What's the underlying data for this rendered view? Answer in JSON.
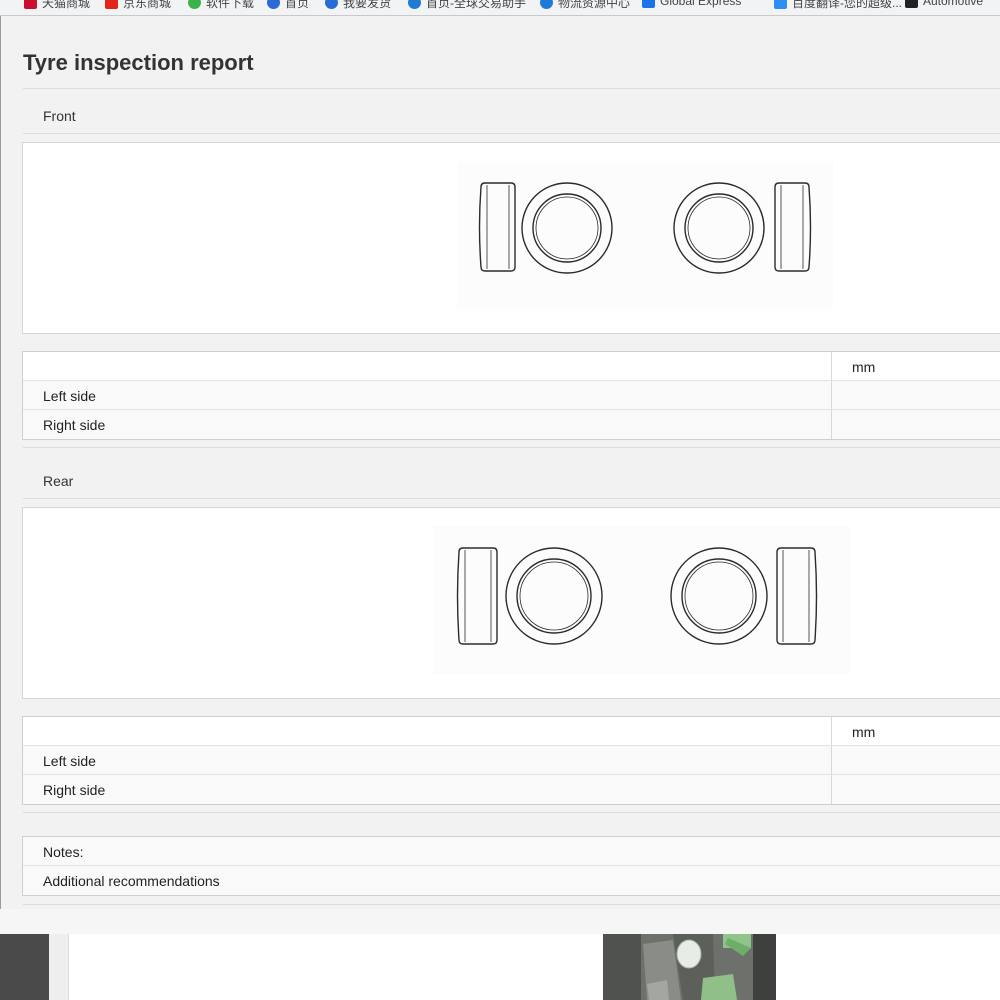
{
  "bookmarks": [
    {
      "label": "天猫商城",
      "color": "#c8102e"
    },
    {
      "label": "京东商城",
      "color": "#e1251b"
    },
    {
      "label": "软件下载",
      "color": "#3bb24a"
    },
    {
      "label": "首页",
      "color": "#2a6ad6"
    },
    {
      "label": "我要发货",
      "color": "#2a6ad6"
    },
    {
      "label": "首页-全球交易助手",
      "color": "#1f7ad6"
    },
    {
      "label": "物流资源中心",
      "color": "#1f7ad6"
    },
    {
      "label": "Global Express",
      "color": "#1a73e8"
    },
    {
      "label": "百度翻译-您的超级...",
      "color": "#2f8ef6"
    },
    {
      "label": "Automotive",
      "color": "#222222"
    }
  ],
  "report": {
    "title": "Tyre inspection report",
    "front": {
      "label": "Front",
      "unit_header": "mm",
      "rows": [
        {
          "label": "Left side",
          "value": ""
        },
        {
          "label": "Right side",
          "value": ""
        }
      ]
    },
    "rear": {
      "label": "Rear",
      "unit_header": "mm",
      "rows": [
        {
          "label": "Left side",
          "value": ""
        },
        {
          "label": "Right side",
          "value": ""
        }
      ]
    },
    "notes_label": "Notes:",
    "recommendations_label": "Additional recommendations"
  }
}
